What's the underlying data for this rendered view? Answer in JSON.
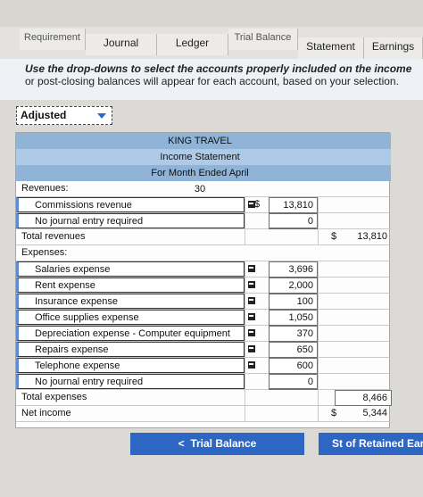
{
  "tabs": [
    {
      "label": "Requirement"
    },
    {
      "label": "Journal"
    },
    {
      "label": "Ledger"
    },
    {
      "label": "Trial Balance"
    },
    {
      "label": "Statement"
    },
    {
      "label": "Earnings"
    }
  ],
  "instruction": {
    "line1": "Use the drop-downs to select the accounts properly included on the income",
    "line2": "or post-closing balances will appear for each account, based on your selection."
  },
  "balance_dropdown": {
    "value": "Adjusted"
  },
  "statement": {
    "company": "KING TRAVEL",
    "title": "Income Statement",
    "period": "For Month Ended April 30",
    "revenues_label": "Revenues:",
    "revenues": [
      {
        "account": "Commissions revenue",
        "currency": "$",
        "amount": "13,810"
      },
      {
        "account": "No journal entry required",
        "amount": "0"
      }
    ],
    "total_revenues": {
      "label": "Total revenues",
      "currency": "$",
      "amount": "13,810"
    },
    "expenses_label": "Expenses:",
    "expenses": [
      {
        "account": "Salaries expense",
        "amount": "3,696"
      },
      {
        "account": "Rent expense",
        "amount": "2,000"
      },
      {
        "account": "Insurance expense",
        "amount": "100"
      },
      {
        "account": "Office supplies expense",
        "amount": "1,050"
      },
      {
        "account": "Depreciation expense - Computer equipment",
        "amount": "370"
      },
      {
        "account": "Repairs expense",
        "amount": "650"
      },
      {
        "account": "Telephone expense",
        "amount": "600"
      },
      {
        "account": "No journal entry required",
        "amount": "0"
      }
    ],
    "total_expenses": {
      "label": "Total expenses",
      "amount": "8,466"
    },
    "net_income": {
      "label": "Net income",
      "currency": "$",
      "amount": "5,344"
    }
  },
  "nav": {
    "prev_label": "Trial Balance",
    "next_label": "St of Retained Earnin"
  }
}
